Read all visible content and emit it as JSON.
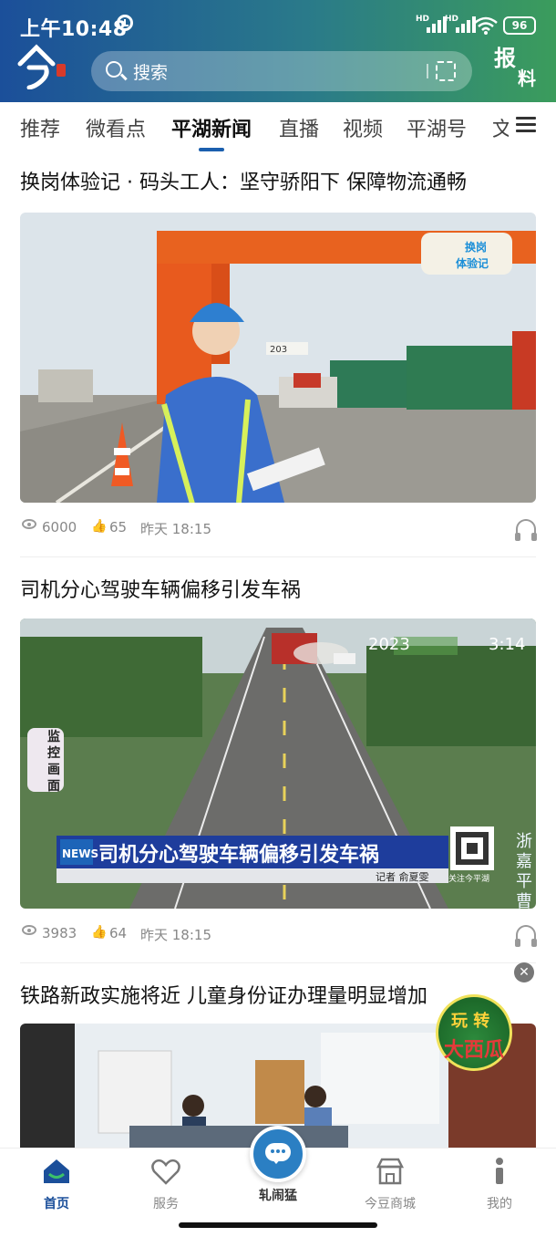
{
  "status_bar": {
    "time": "上午10:48",
    "battery": "96",
    "network_1": "HD",
    "network_2": "HD"
  },
  "header": {
    "search_placeholder": "搜索",
    "report_label_1": "报",
    "report_label_2": "料",
    "colors": {
      "start": "#1b4f9a",
      "end": "#3b9c5c"
    }
  },
  "tabs": [
    {
      "label": "推荐"
    },
    {
      "label": "微看点"
    },
    {
      "label": "平湖新闻",
      "active": true
    },
    {
      "label": "直播"
    },
    {
      "label": "视频"
    },
    {
      "label": "平湖号"
    },
    {
      "label": "文"
    }
  ],
  "articles": [
    {
      "title": "换岗体验记 · 码头工人：坚守骄阳下 保障物流通畅",
      "views": "6000",
      "likes": "65",
      "time": "昨天  18:15",
      "badge": "换岗\n体验记",
      "container_number": "203"
    },
    {
      "title": "司机分心驾驶车辆偏移引发车祸",
      "views": "3983",
      "likes": "64",
      "time": "昨天  18:15",
      "overlay_headline": "司机分心驾驶车辆偏移引发车祸",
      "overlay_reporter": "记者  俞夏雯",
      "overlay_news": "NEWS",
      "overlay_timestamp_left": "2023",
      "overlay_timestamp_right": "3:14",
      "overlay_side": "监控画面",
      "overlay_qr": "关注今平湖",
      "overlay_channel": "浙嘉平曹"
    },
    {
      "title": "铁路新政实施将近  儿童身份证办理量明显增加"
    }
  ],
  "float_ad": {
    "line1": "玩 转",
    "line2": "大西瓜"
  },
  "bottom_nav": [
    {
      "label": "首页",
      "active": true
    },
    {
      "label": "服务"
    },
    {
      "label": "轧闹猛"
    },
    {
      "label": "今豆商城"
    },
    {
      "label": "我的"
    }
  ]
}
